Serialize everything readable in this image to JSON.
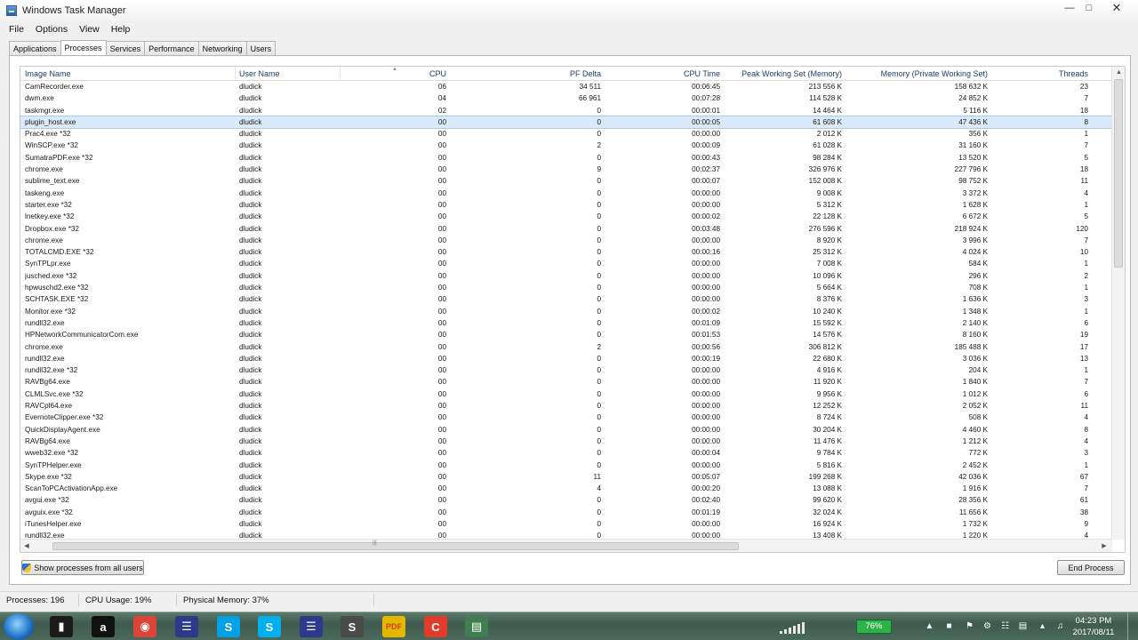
{
  "window": {
    "title": "Windows Task Manager"
  },
  "menu": [
    "File",
    "Options",
    "View",
    "Help"
  ],
  "tabs": [
    {
      "label": "Applications",
      "active": false
    },
    {
      "label": "Processes",
      "active": true
    },
    {
      "label": "Services",
      "active": false
    },
    {
      "label": "Performance",
      "active": false
    },
    {
      "label": "Networking",
      "active": false
    },
    {
      "label": "Users",
      "active": false
    }
  ],
  "table": {
    "columns": [
      "Image Name",
      "User Name",
      "CPU",
      "PF Delta",
      "CPU Time",
      "Peak Working Set (Memory)",
      "Memory (Private Working Set)",
      "Threads"
    ],
    "rows": [
      [
        "CamRecorder.exe",
        "dludick",
        "06",
        "34 511",
        "00:06:45",
        "213 556 K",
        "158 632 K",
        "23"
      ],
      [
        "dwm.exe",
        "dludick",
        "04",
        "66 961",
        "00:07:28",
        "114 528 K",
        "24 852 K",
        "7"
      ],
      [
        "taskmgr.exe",
        "dludick",
        "02",
        "0",
        "00:00:01",
        "14 464 K",
        "5 116 K",
        "18"
      ],
      [
        "plugin_host.exe",
        "dludick",
        "00",
        "0",
        "00:00:05",
        "61 608 K",
        "47 436 K",
        "8"
      ],
      [
        "Prac4.exe *32",
        "dludick",
        "00",
        "0",
        "00:00:00",
        "2 012 K",
        "356 K",
        "1"
      ],
      [
        "WinSCP.exe *32",
        "dludick",
        "00",
        "2",
        "00:00:09",
        "61 028 K",
        "31 160 K",
        "7"
      ],
      [
        "SumatraPDF.exe *32",
        "dludick",
        "00",
        "0",
        "00:00:43",
        "98 284 K",
        "13 520 K",
        "5"
      ],
      [
        "chrome.exe",
        "dludick",
        "00",
        "9",
        "00:02:37",
        "326 976 K",
        "227 796 K",
        "18"
      ],
      [
        "sublime_text.exe",
        "dludick",
        "00",
        "0",
        "00:00:07",
        "152 008 K",
        "98 752 K",
        "11"
      ],
      [
        "taskeng.exe",
        "dludick",
        "00",
        "0",
        "00:00:00",
        "9 008 K",
        "3 372 K",
        "4"
      ],
      [
        "starter.exe *32",
        "dludick",
        "00",
        "0",
        "00:00:00",
        "5 312 K",
        "1 628 K",
        "1"
      ],
      [
        "lnetkey.exe *32",
        "dludick",
        "00",
        "0",
        "00:00:02",
        "22 128 K",
        "6 672 K",
        "5"
      ],
      [
        "Dropbox.exe *32",
        "dludick",
        "00",
        "0",
        "00:03:48",
        "276 596 K",
        "218 924 K",
        "120"
      ],
      [
        "chrome.exe",
        "dludick",
        "00",
        "0",
        "00:00:00",
        "8 920 K",
        "3 996 K",
        "7"
      ],
      [
        "TOTALCMD.EXE *32",
        "dludick",
        "00",
        "0",
        "00:00:16",
        "25 312 K",
        "4 024 K",
        "10"
      ],
      [
        "SynTPLpr.exe",
        "dludick",
        "00",
        "0",
        "00:00:00",
        "7 008 K",
        "584 K",
        "1"
      ],
      [
        "jusched.exe *32",
        "dludick",
        "00",
        "0",
        "00:00:00",
        "10 096 K",
        "296 K",
        "2"
      ],
      [
        "hpwuschd2.exe *32",
        "dludick",
        "00",
        "0",
        "00:00:00",
        "5 664 K",
        "708 K",
        "1"
      ],
      [
        "SCHTASK.EXE *32",
        "dludick",
        "00",
        "0",
        "00:00:00",
        "8 376 K",
        "1 636 K",
        "3"
      ],
      [
        "Monitor.exe *32",
        "dludick",
        "00",
        "0",
        "00:00:02",
        "10 240 K",
        "1 348 K",
        "1"
      ],
      [
        "rundll32.exe",
        "dludick",
        "00",
        "0",
        "00:01:09",
        "15 592 K",
        "2 140 K",
        "6"
      ],
      [
        "HPNetworkCommunicatorCom.exe",
        "dludick",
        "00",
        "0",
        "00:01:53",
        "14 576 K",
        "8 160 K",
        "19"
      ],
      [
        "chrome.exe",
        "dludick",
        "00",
        "2",
        "00:00:56",
        "306 812 K",
        "185 488 K",
        "17"
      ],
      [
        "rundll32.exe",
        "dludick",
        "00",
        "0",
        "00:00:19",
        "22 680 K",
        "3 036 K",
        "13"
      ],
      [
        "rundll32.exe *32",
        "dludick",
        "00",
        "0",
        "00:00:00",
        "4 916 K",
        "204 K",
        "1"
      ],
      [
        "RAVBg64.exe",
        "dludick",
        "00",
        "0",
        "00:00:00",
        "11 920 K",
        "1 840 K",
        "7"
      ],
      [
        "CLMLSvc.exe *32",
        "dludick",
        "00",
        "0",
        "00:00:00",
        "9 956 K",
        "1 012 K",
        "6"
      ],
      [
        "RAVCpl64.exe",
        "dludick",
        "00",
        "0",
        "00:00:00",
        "12 252 K",
        "2 052 K",
        "11"
      ],
      [
        "EvernoteClipper.exe *32",
        "dludick",
        "00",
        "0",
        "00:00:00",
        "8 724 K",
        "508 K",
        "4"
      ],
      [
        "QuickDisplayAgent.exe",
        "dludick",
        "00",
        "0",
        "00:00:00",
        "30 204 K",
        "4 460 K",
        "8"
      ],
      [
        "RAVBg64.exe",
        "dludick",
        "00",
        "0",
        "00:00:00",
        "11 476 K",
        "1 212 K",
        "4"
      ],
      [
        "wweb32.exe *32",
        "dludick",
        "00",
        "0",
        "00:00:04",
        "9 784 K",
        "772 K",
        "3"
      ],
      [
        "SynTPHelper.exe",
        "dludick",
        "00",
        "0",
        "00:00:00",
        "5 816 K",
        "2 452 K",
        "1"
      ],
      [
        "Skype.exe *32",
        "dludick",
        "00",
        "11",
        "00:05:07",
        "199 268 K",
        "42 036 K",
        "67"
      ],
      [
        "ScanToPCActivationApp.exe",
        "dludick",
        "00",
        "4",
        "00:00:20",
        "13 088 K",
        "1 916 K",
        "7"
      ],
      [
        "avgui.exe *32",
        "dludick",
        "00",
        "0",
        "00:02:40",
        "99 620 K",
        "28 356 K",
        "61"
      ],
      [
        "avguix.exe *32",
        "dludick",
        "00",
        "0",
        "00:01:19",
        "32 024 K",
        "11 656 K",
        "38"
      ],
      [
        "iTunesHelper.exe",
        "dludick",
        "00",
        "0",
        "00:00:00",
        "16 924 K",
        "1 732 K",
        "9"
      ],
      [
        "rundll32.exe",
        "dludick",
        "00",
        "0",
        "00:00:00",
        "13 408 K",
        "1 220 K",
        "4"
      ]
    ],
    "selected_row": 3
  },
  "buttons": {
    "show_all": "Show processes from all users",
    "end_process": "End Process"
  },
  "status": {
    "processes": "Processes: 196",
    "cpu": "CPU Usage: 19%",
    "memory": "Physical Memory: 37%"
  },
  "taskbar": {
    "apps": [
      {
        "name": "terminal-icon",
        "glyph": "▮",
        "color": "#1b1b1b"
      },
      {
        "name": "amazon-icon",
        "glyph": "a",
        "color": "#111111"
      },
      {
        "name": "chrome-icon",
        "glyph": "◉",
        "color": "#db4437"
      },
      {
        "name": "virtualbox-icon",
        "glyph": "☰",
        "color": "#2d3a8c"
      },
      {
        "name": "skype-business-icon",
        "glyph": "S",
        "color": "#00a1e6"
      },
      {
        "name": "skype-icon",
        "glyph": "S",
        "color": "#00aff0"
      },
      {
        "name": "virtualbox-2-icon",
        "glyph": "☰",
        "color": "#2d3a8c"
      },
      {
        "name": "sublime-icon",
        "glyph": "S",
        "color": "#4a4a4a"
      },
      {
        "name": "pdf-icon",
        "glyph": "PDF",
        "color": "#e5b800"
      },
      {
        "name": "recorder-icon",
        "glyph": "C",
        "color": "#e23b2a"
      },
      {
        "name": "taskmgr-icon",
        "glyph": "▤",
        "color": "#3f7f4f"
      }
    ],
    "battery": "76%",
    "time": "04:23 PM",
    "date": "2017/08/11"
  },
  "colors": {
    "selection": "#dbeafb",
    "header_text": "#1f3f6e",
    "battery": "#2fb24a"
  }
}
